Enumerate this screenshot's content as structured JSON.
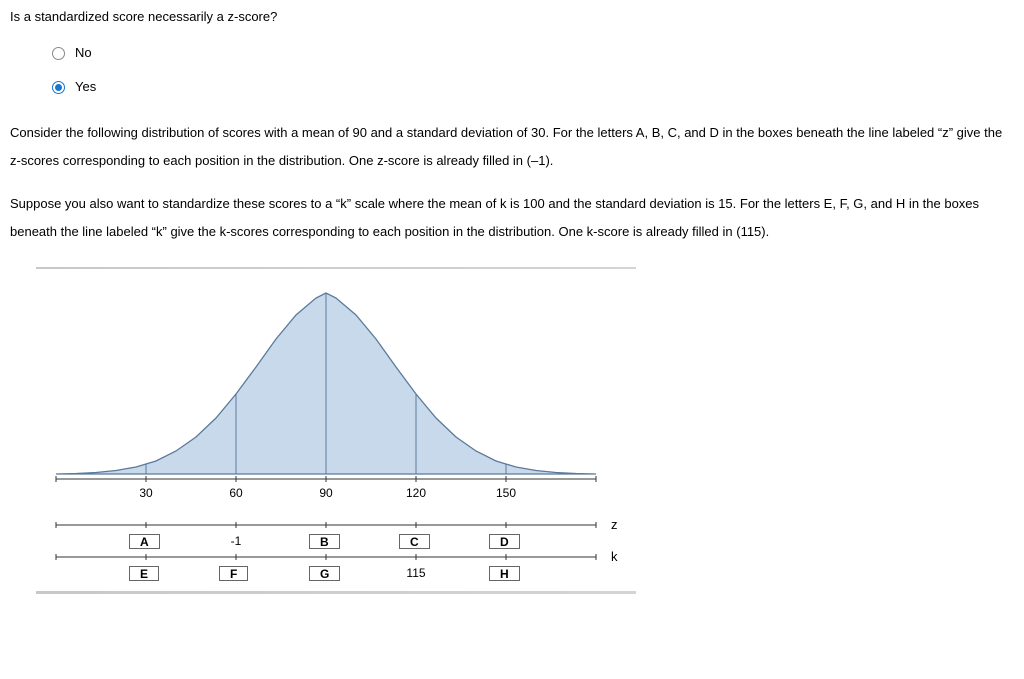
{
  "question1": {
    "text": "Is a standardized score necessarily a z-score?",
    "options": {
      "no": "No",
      "yes": "Yes"
    },
    "selected": "yes"
  },
  "question2": {
    "para1": "Consider the following distribution of scores with a mean of 90 and a standard deviation of 30. For the letters A, B, C, and D in the boxes beneath the line labeled “z” give the z-scores corresponding to each position in the distribution. One z-score is already filled in (–1).",
    "para2": "Suppose you also want to standardize these scores to a “k” scale where the mean of k is 100 and the standard deviation is 15. For the letters E, F, G, and H in the boxes beneath the line labeled “k” give the k-scores corresponding to each position in the distribution. One k-score is already filled in (115)."
  },
  "chart_data": {
    "type": "distribution",
    "axis_values": [
      "30",
      "60",
      "90",
      "120",
      "150"
    ],
    "z_row": {
      "label": "z",
      "cells": [
        {
          "type": "box",
          "value": "A"
        },
        {
          "type": "text",
          "value": "-1"
        },
        {
          "type": "box",
          "value": "B"
        },
        {
          "type": "box",
          "value": "C"
        },
        {
          "type": "box",
          "value": "D"
        }
      ]
    },
    "k_row": {
      "label": "k",
      "cells": [
        {
          "type": "box",
          "value": "E"
        },
        {
          "type": "box",
          "value": "F"
        },
        {
          "type": "box",
          "value": "G"
        },
        {
          "type": "text",
          "value": "115"
        },
        {
          "type": "box",
          "value": "H"
        }
      ]
    }
  }
}
